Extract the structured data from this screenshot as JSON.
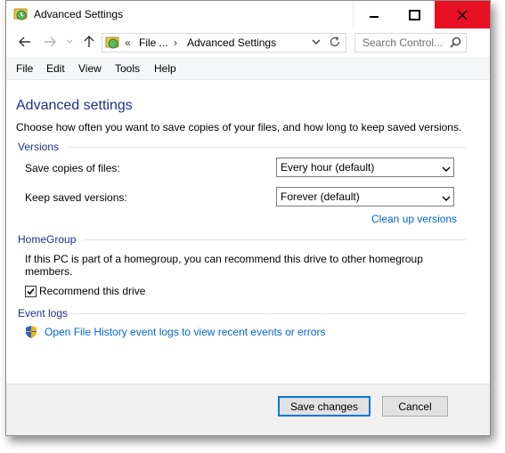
{
  "window": {
    "title": "Advanced Settings",
    "icon": "file-history-icon"
  },
  "navbar": {
    "address_prefix": "«",
    "crumb_1": "File ...",
    "crumb_separator": "›",
    "crumb_2": "Advanced Settings",
    "search_placeholder": "Search Control..."
  },
  "menu": {
    "items": [
      "File",
      "Edit",
      "View",
      "Tools",
      "Help"
    ]
  },
  "content": {
    "heading": "Advanced settings",
    "description": "Choose how often you want to save copies of your files, and how long to keep saved versions.",
    "versions": {
      "title": "Versions",
      "save_copies_label": "Save copies of files:",
      "save_copies_value": "Every hour (default)",
      "keep_versions_label": "Keep saved versions:",
      "keep_versions_value": "Forever (default)",
      "cleanup_link": "Clean up versions"
    },
    "homegroup": {
      "title": "HomeGroup",
      "text": "If this PC is part of a homegroup, you can recommend this drive to other homegroup members.",
      "checkbox_label": "Recommend this drive",
      "checkbox_checked": true
    },
    "event_logs": {
      "title": "Event logs",
      "link": "Open File History event logs to view recent events or errors"
    }
  },
  "footer": {
    "save_label": "Save changes",
    "cancel_label": "Cancel"
  },
  "colors": {
    "heading": "#1e3287",
    "link": "#0066cc",
    "close_button": "#e81123",
    "primary_border": "#0078d7"
  }
}
